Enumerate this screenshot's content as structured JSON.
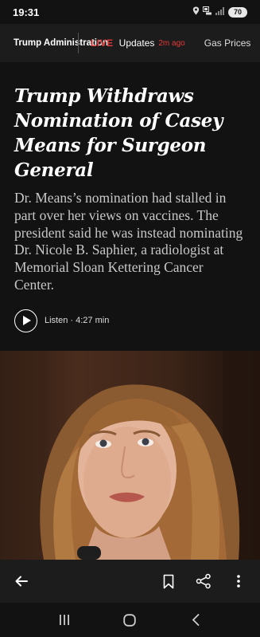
{
  "status_bar": {
    "time": "19:31",
    "battery": "70"
  },
  "section_nav": {
    "section_title": "Trump Administration",
    "live_label": "LIVE",
    "updates_label": "Updates",
    "updated_ago": "2m ago",
    "next_item": "Gas Prices"
  },
  "article": {
    "headline": "Trump Withdraws Nomination of Casey Means for Surgeon General",
    "summary": "Dr. Means’s nomination had stalled in part over her views on vaccines. The president said he was instead nominating Dr. Nicole B. Saphier, a radiologist at Memorial Sloan Kettering Cancer Center.",
    "listen_label": "Listen · 4:27 min"
  },
  "colors": {
    "accent_live": "#e5393a",
    "background": "#121212",
    "nav_background": "#1c1c1c"
  },
  "toolbar": {
    "icons": [
      "back-arrow-icon",
      "bookmark-icon",
      "share-icon",
      "more-options-icon"
    ]
  },
  "system_nav": {
    "icons": [
      "recent-apps-icon",
      "home-icon",
      "back-icon"
    ]
  }
}
